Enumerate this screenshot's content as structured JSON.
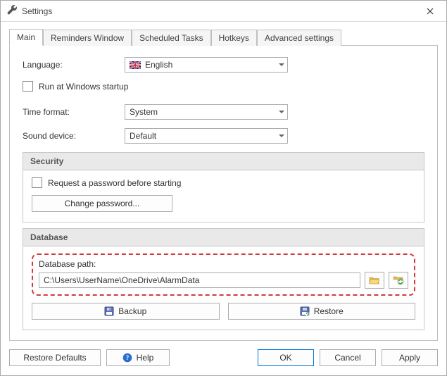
{
  "window": {
    "title": "Settings"
  },
  "tabs": {
    "main": "Main",
    "reminders": "Reminders Window",
    "scheduled": "Scheduled Tasks",
    "hotkeys": "Hotkeys",
    "advanced": "Advanced settings"
  },
  "main": {
    "language_label": "Language:",
    "language_value": "English",
    "run_startup": "Run at Windows startup",
    "time_format_label": "Time format:",
    "time_format_value": "System",
    "sound_device_label": "Sound device:",
    "sound_device_value": "Default"
  },
  "security": {
    "title": "Security",
    "request_password": "Request a password before starting",
    "change_password": "Change password..."
  },
  "database": {
    "title": "Database",
    "path_label": "Database path:",
    "path_value": "C:\\Users\\UserName\\OneDrive\\AlarmData",
    "backup": "Backup",
    "restore": "Restore"
  },
  "footer": {
    "restore_defaults": "Restore Defaults",
    "help": "Help",
    "ok": "OK",
    "cancel": "Cancel",
    "apply": "Apply"
  }
}
